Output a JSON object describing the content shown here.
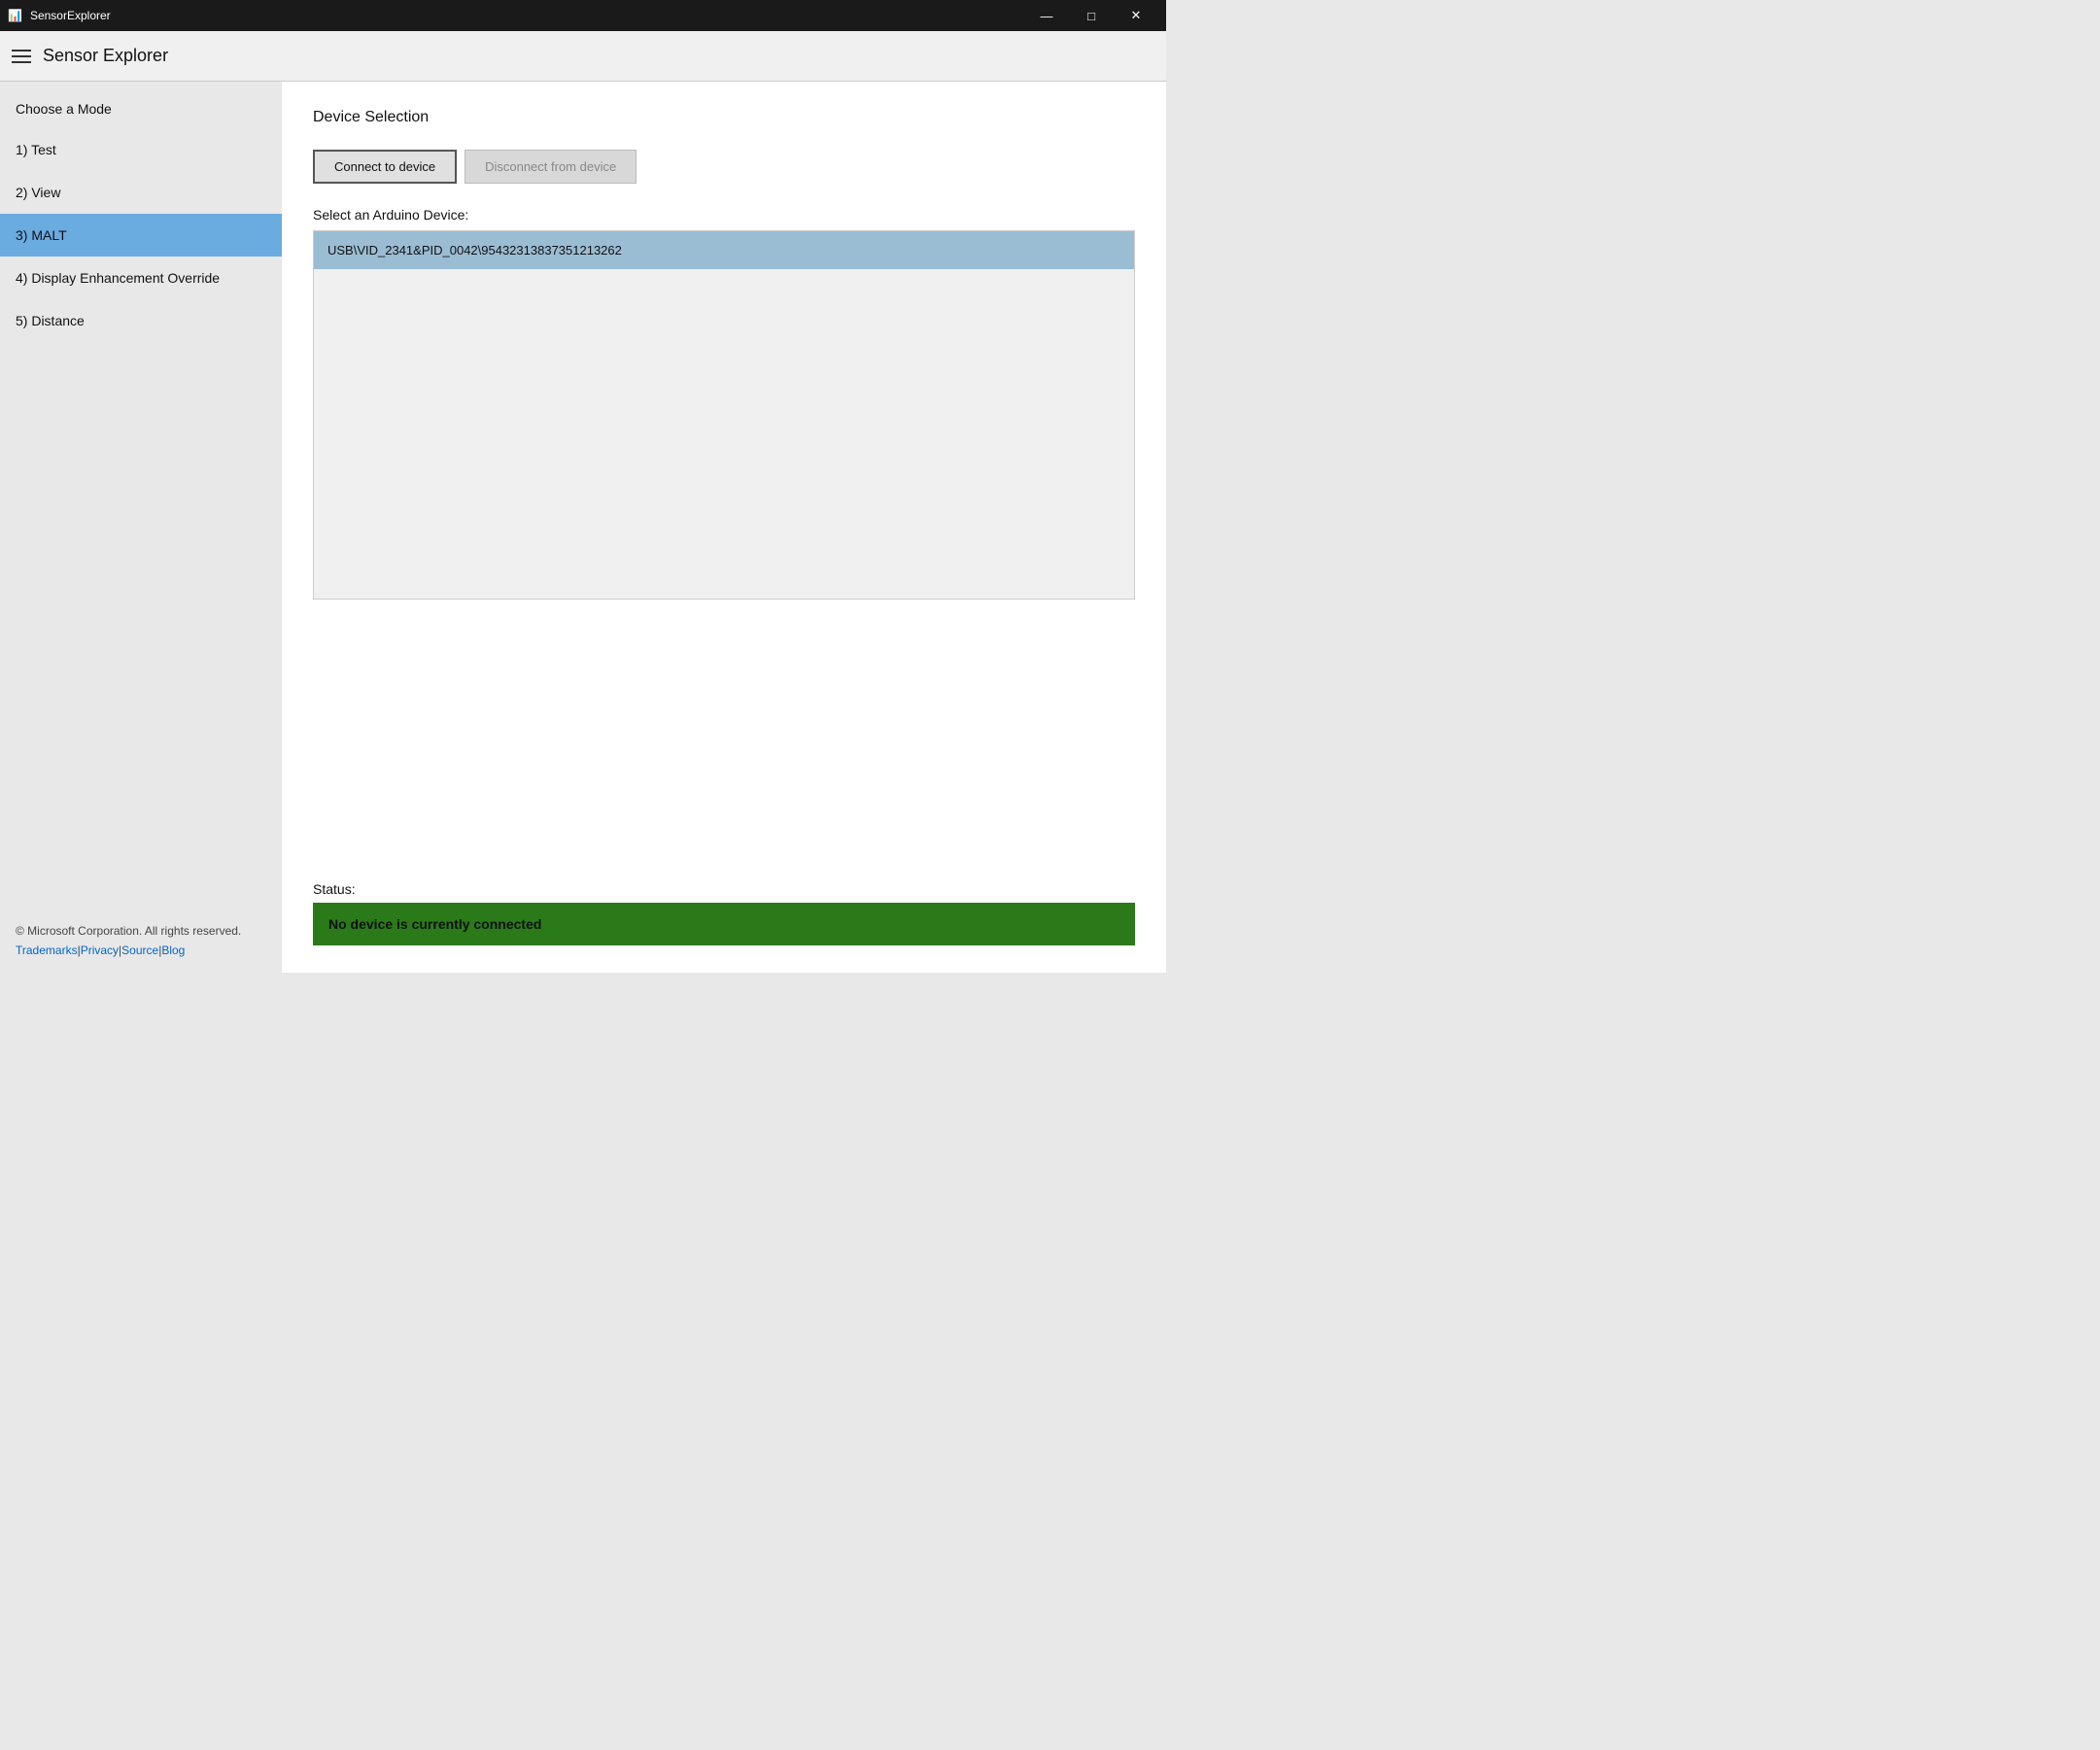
{
  "titlebar": {
    "app_name": "SensorExplorer",
    "minimize_label": "—",
    "maximize_label": "□",
    "close_label": "✕"
  },
  "header": {
    "title": "Sensor Explorer"
  },
  "sidebar": {
    "choose_mode_label": "Choose a Mode",
    "items": [
      {
        "id": "test",
        "label": "1) Test",
        "active": false
      },
      {
        "id": "view",
        "label": "2) View",
        "active": false
      },
      {
        "id": "malt",
        "label": "3) MALT",
        "active": true
      },
      {
        "id": "display-enhancement",
        "label": "4) Display Enhancement Override",
        "active": false
      },
      {
        "id": "distance",
        "label": "5) Distance",
        "active": false
      }
    ],
    "footer_text": "© Microsoft Corporation. All rights reserved.",
    "links": [
      {
        "label": "Trademarks",
        "url": "#"
      },
      {
        "label": "Privacy",
        "url": "#"
      },
      {
        "label": "Source",
        "url": "#"
      },
      {
        "label": "Blog",
        "url": "#"
      }
    ]
  },
  "content": {
    "section_title": "Device Selection",
    "connect_button": "Connect to device",
    "disconnect_button": "Disconnect from device",
    "device_list_label": "Select an Arduino Device:",
    "devices": [
      {
        "id": "device1",
        "label": "USB\\VID_2341&PID_0042\\95432313837351213262",
        "selected": true
      }
    ],
    "status_label": "Status:",
    "status_text": "No device is currently connected"
  }
}
